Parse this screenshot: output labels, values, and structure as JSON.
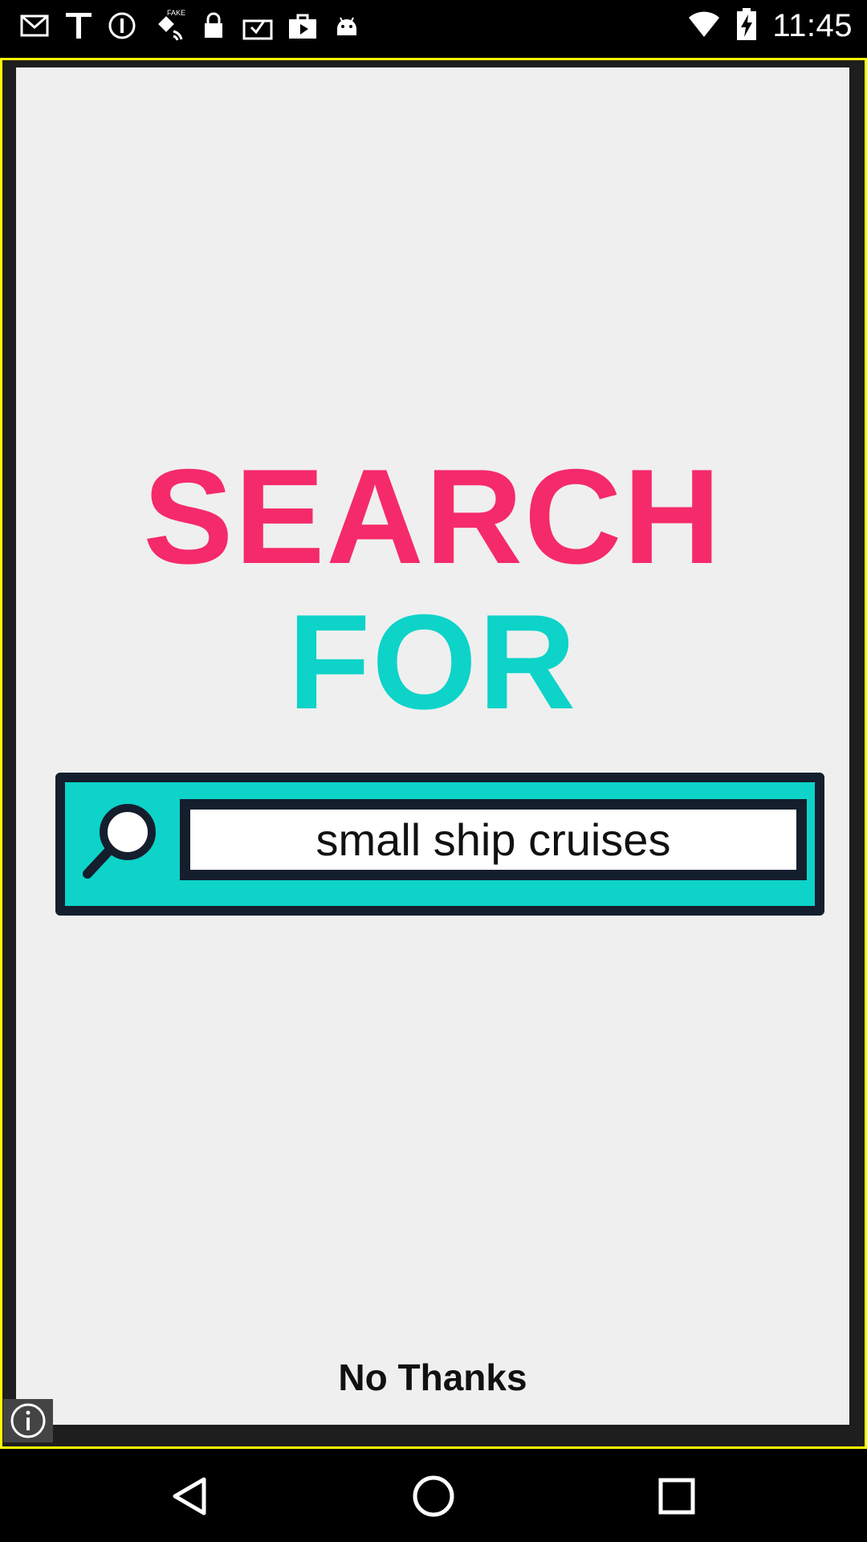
{
  "status_bar": {
    "time": "11:45",
    "left_icons": [
      "gmail-icon",
      "text-icon",
      "info-circle-icon",
      "fake-gps-icon",
      "lock-icon",
      "clipboard-check-icon",
      "play-bag-icon",
      "android-icon"
    ],
    "right_icons": [
      "wifi-icon",
      "battery-charging-icon"
    ]
  },
  "ad": {
    "headline_line1": "SEARCH",
    "headline_line2": "FOR",
    "search_query": "small ship cruises",
    "dismiss_label": "No Thanks",
    "colors": {
      "headline_pink": "#f52a6b",
      "accent_teal": "#0dd3c8",
      "box_dark": "#141e2d",
      "frame_yellow": "#ffff00"
    }
  },
  "nav_bar": {
    "buttons": [
      "back-icon",
      "home-icon",
      "recents-icon"
    ]
  }
}
